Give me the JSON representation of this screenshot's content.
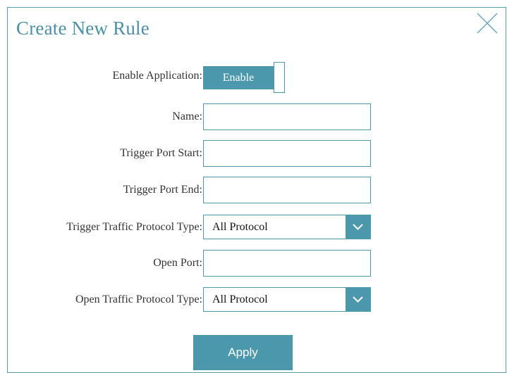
{
  "dialog": {
    "title": "Create New Rule",
    "close_icon": "close-icon"
  },
  "form": {
    "enable_application": {
      "label": "Enable Application:",
      "value": "Enable"
    },
    "name": {
      "label": "Name:",
      "value": ""
    },
    "trigger_port_start": {
      "label": "Trigger Port Start:",
      "value": ""
    },
    "trigger_port_end": {
      "label": "Trigger Port End:",
      "value": ""
    },
    "trigger_protocol": {
      "label": "Trigger Traffic Protocol Type:",
      "value": "All Protocol"
    },
    "open_port": {
      "label": "Open Port:",
      "value": ""
    },
    "open_protocol": {
      "label": "Open Traffic Protocol Type:",
      "value": "All Protocol"
    }
  },
  "actions": {
    "apply_label": "Apply"
  },
  "colors": {
    "accent": "#4b98ad",
    "title": "#4b90a6",
    "border": "#5a9fb0"
  }
}
